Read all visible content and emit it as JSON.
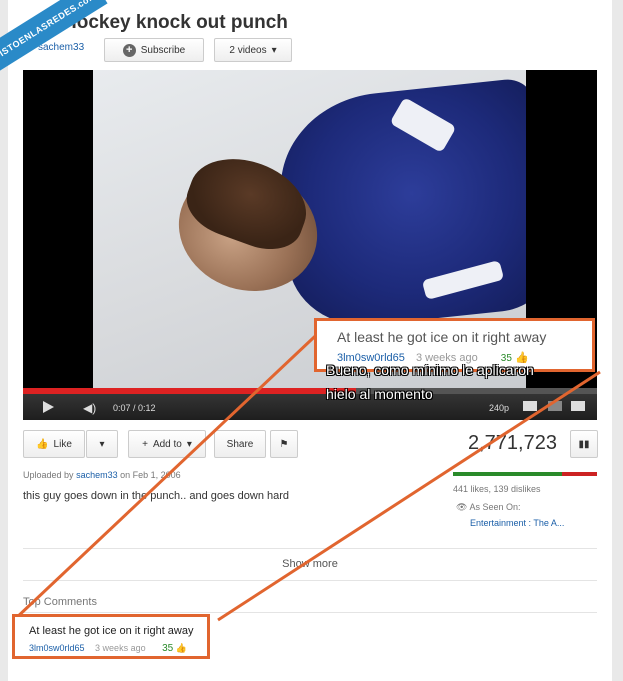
{
  "watermark": "VISTOENLASREDES.com",
  "video": {
    "title": "Hockey knock out punch",
    "time": "0:07 / 0:12",
    "quality": "240p",
    "progress": 0.58
  },
  "channel": {
    "name": "sachem33",
    "subscribe_label": "Subscribe",
    "videos_label": "2 videos"
  },
  "actions": {
    "like": "Like",
    "add_to": "Add to",
    "share": "Share"
  },
  "stats": {
    "views": "2,771,723",
    "likes_dislikes": "441 likes, 139 dislikes",
    "like_ratio": 0.76
  },
  "uploader": {
    "prefix": "Uploaded by",
    "name": "sachem33",
    "on": "on Feb 1, 2006"
  },
  "description": "this guy goes down in the punch.. and goes down hard",
  "as_seen_on": {
    "label": "As Seen On:",
    "value": "Entertainment : The A..."
  },
  "show_more": "Show more",
  "top_comments_label": "Top Comments",
  "comment": {
    "text": "At least he got ice on it right away",
    "user": "3lm0sw0rld65",
    "age": "3 weeks ago",
    "likes": "35"
  },
  "translation": {
    "line1": "Bueno, como mínimo le aplicaron",
    "line2": "hielo al momento"
  },
  "colors": {
    "accent": "#e1652f",
    "link": "#1b5fa8",
    "progress": "#dd2222",
    "likes_green": "#2a8a2a"
  }
}
